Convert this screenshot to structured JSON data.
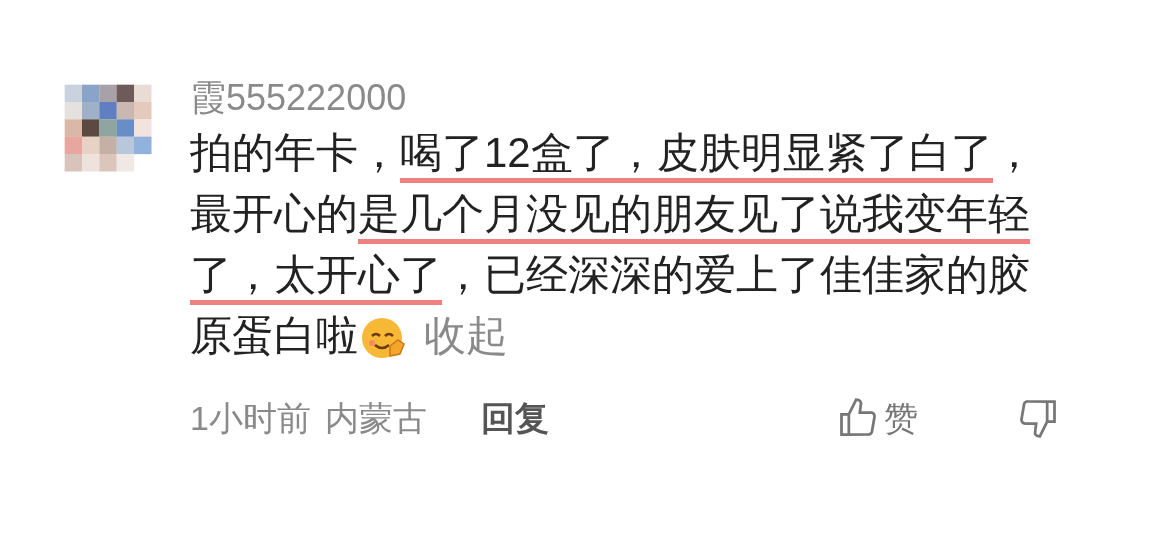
{
  "comment": {
    "username": "霞555222000",
    "lines": [
      [
        {
          "text": "拍的年卡，",
          "underlined": false
        },
        {
          "text": "喝了12盒了，皮肤明显紧了白了",
          "underlined": true
        },
        {
          "text": "，",
          "underlined": false
        }
      ],
      [
        {
          "text": "最开心的",
          "underlined": false
        },
        {
          "text": "是几个月没见的朋友见了说我变年轻",
          "underlined": true
        }
      ],
      [
        {
          "text": "了，太开心了",
          "underlined": true
        },
        {
          "text": "，已经深深的爱上了佳佳家的胶",
          "underlined": false
        }
      ],
      [
        {
          "text": "原蛋白啦",
          "underlined": false
        }
      ]
    ],
    "collapse_link": "收起",
    "time": "1小时前",
    "location": "内蒙古",
    "reply": "回复",
    "like": "赞"
  }
}
